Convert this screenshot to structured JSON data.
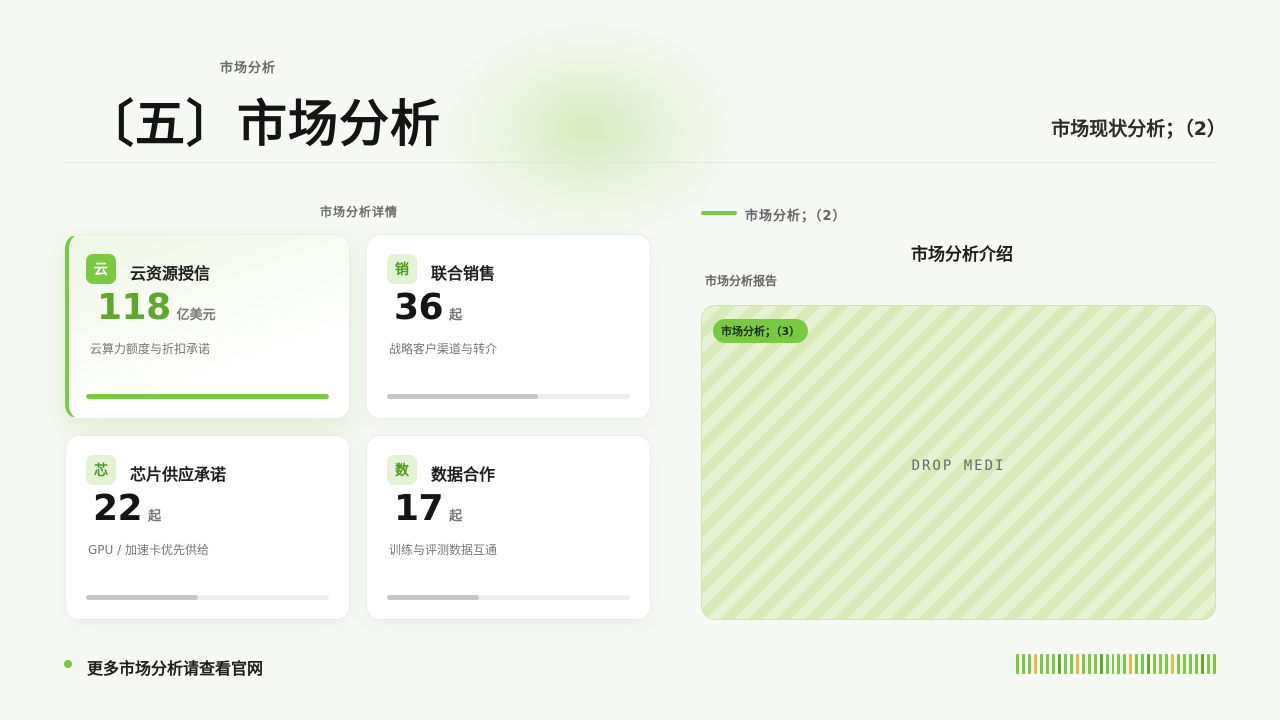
{
  "header": {
    "eyebrow": "市场分析",
    "title": "〔五〕市场分析",
    "right_title": "市场现状分析；（2）"
  },
  "section": {
    "label": "市场分析详情"
  },
  "cards": [
    {
      "icon_text": "云",
      "title": "云资源授信",
      "value": "118",
      "unit": "亿美元",
      "desc": "云算力额度与折扣承诺",
      "progress_pct": 100,
      "active": true
    },
    {
      "icon_text": "销",
      "title": "联合销售",
      "value": "36",
      "unit": "起",
      "desc": "战略客户渠道与转介",
      "progress_pct": 62,
      "active": false
    },
    {
      "icon_text": "芯",
      "title": "芯片供应承诺",
      "value": "22",
      "unit": "起",
      "desc": "GPU / 加速卡优先供给",
      "progress_pct": 46,
      "active": false
    },
    {
      "icon_text": "数",
      "title": "数据合作",
      "value": "17",
      "unit": "起",
      "desc": "训练与评测数据互通",
      "progress_pct": 38,
      "active": false
    }
  ],
  "panel": {
    "legend": "市场分析；（2）",
    "title": "市场分析介绍",
    "subtitle": "市场分析报告",
    "badge": "市场分析；（3）",
    "drop_text": "DROP MEDI"
  },
  "footer": {
    "text": "更多市场分析请查看官网"
  },
  "colors": {
    "accent": "#7ac943",
    "background": "#f6f8f3",
    "barcode": [
      "#7ac943",
      "#f0b548",
      "#5fa82c"
    ]
  }
}
